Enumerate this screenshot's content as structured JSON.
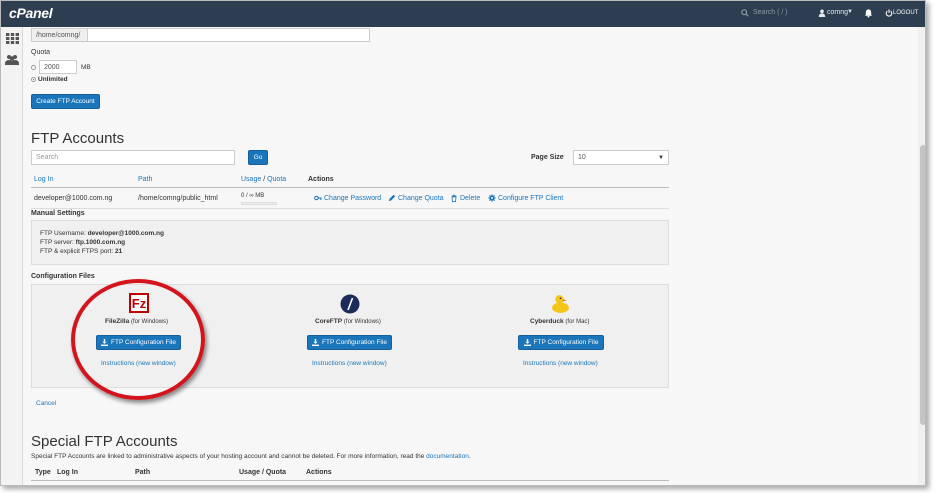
{
  "topbar": {
    "logo": "cPanel",
    "search_placeholder": "Search ( / )",
    "user": "comng",
    "logout": "LOGOUT"
  },
  "form": {
    "dir_prefix": "/home/comng/",
    "dir_value": "",
    "quota_label": "Quota",
    "quota_value": "2000",
    "quota_unit": "MB",
    "unlimited_label": "Unlimited",
    "create_button": "Create FTP Account"
  },
  "ftp_accounts": {
    "title": "FTP Accounts",
    "search_placeholder": "Search",
    "go_button": "Go",
    "page_size_label": "Page Size",
    "page_size_value": "10",
    "columns": {
      "login": "Log In",
      "path": "Path",
      "usage": "Usage",
      "slash": "/",
      "quota": "Quota",
      "actions": "Actions"
    },
    "row": {
      "login": "developer@1000.com.ng",
      "path": "/home/comng/public_html",
      "usage": "0 / ∞ MB",
      "change_password": "Change Password",
      "change_quota": "Change Quota",
      "delete": "Delete",
      "configure": "Configure FTP Client"
    }
  },
  "manual": {
    "title": "Manual Settings",
    "username_label": "FTP Username:",
    "username_value": "developer@1000.com.ng",
    "server_label": "FTP server:",
    "server_value": "ftp.1000.com.ng",
    "port_label": "FTP & explicit FTPS port:",
    "port_value": "21"
  },
  "config_files": {
    "title": "Configuration Files",
    "clients": [
      {
        "name": "FileZilla",
        "platform": "(for Windows)",
        "button": "FTP Configuration File",
        "instructions": "Instructions (new window)"
      },
      {
        "name": "CoreFTP",
        "platform": "(for Windows)",
        "button": "FTP Configuration File",
        "instructions": "Instructions (new window)"
      },
      {
        "name": "Cyberduck",
        "platform": "(for Mac)",
        "button": "FTP Configuration File",
        "instructions": "Instructions (new window)"
      }
    ],
    "cancel": "Cancel"
  },
  "special": {
    "title": "Special FTP Accounts",
    "description": "Special FTP Accounts are linked to administrative aspects of your hosting account and cannot be deleted. For more information, read the",
    "doc_link": "documentation",
    "doc_period": ".",
    "columns": {
      "type": "Type",
      "login": "Log In",
      "path": "Path",
      "usage_quota": "Usage / Quota",
      "actions": "Actions"
    }
  },
  "colors": {
    "topbar": "#2d3e50",
    "accent": "#1a75bb",
    "highlight_circle": "#d4141d"
  }
}
